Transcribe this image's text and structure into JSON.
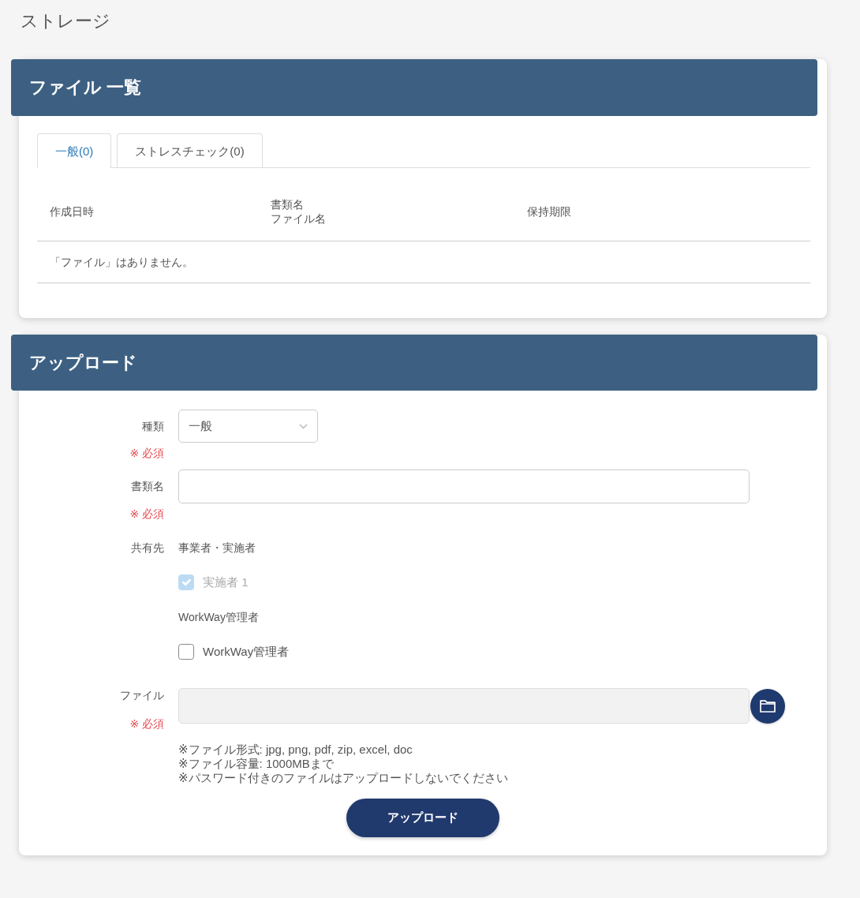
{
  "page": {
    "title": "ストレージ"
  },
  "file_list": {
    "title": "ファイル 一覧",
    "tabs": [
      {
        "label": "一般(0)",
        "selected": true
      },
      {
        "label": "ストレスチェック(0)",
        "selected": false
      }
    ],
    "table": {
      "columns": [
        {
          "lines": [
            "作成日時"
          ]
        },
        {
          "lines": [
            "書類名",
            "ファイル名"
          ]
        },
        {
          "lines": [
            "保持期限"
          ]
        }
      ],
      "empty_message": "「ファイル」はありません。"
    }
  },
  "upload": {
    "title": "アップロード",
    "fields": [
      {
        "kind": "select",
        "label": "種類",
        "required_note": "※ 必須",
        "value": "一般"
      },
      {
        "kind": "text",
        "label": "書類名",
        "required_note": "※ 必須"
      },
      {
        "kind": "share",
        "label": "共有先",
        "groups": [
          {
            "title": "事業者・実施者",
            "options": [
              {
                "label": "実施者 1",
                "checked": true,
                "disabled": true
              }
            ]
          },
          {
            "title": "WorkWay管理者",
            "options": [
              {
                "label": "WorkWay管理者",
                "checked": false,
                "disabled": false
              }
            ]
          }
        ]
      },
      {
        "kind": "file",
        "label": "ファイル",
        "required_note": "※ 必須"
      }
    ],
    "notes": [
      "※ファイル形式: jpg, png, pdf, zip, excel, doc",
      "※ファイル容量: 1000MBまで",
      "※パスワード付きのファイルはアップロードしないでください"
    ],
    "submit": "アップロード"
  }
}
